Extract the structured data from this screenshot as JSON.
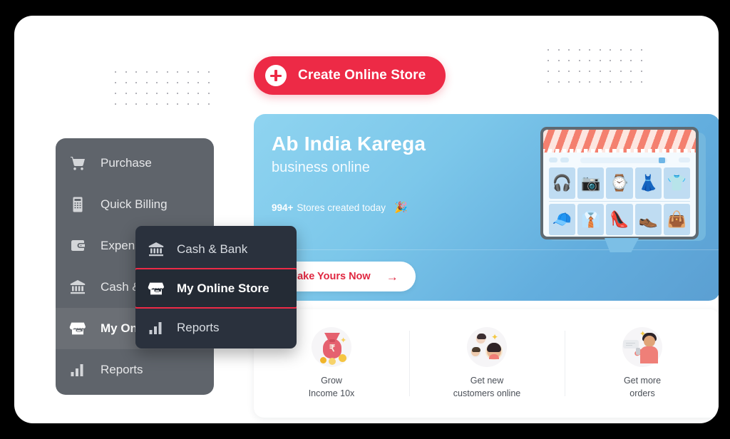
{
  "window": {
    "background_color": "#000000",
    "card_color": "#ffffff"
  },
  "theme": {
    "accent_red": "#ed2a46",
    "hero_blue_light": "#8fd4f0",
    "hero_blue_dark": "#5b9fd2",
    "sidebar_gray": "#5f646b",
    "flyout_dark": "#2a313d"
  },
  "toolbar": {
    "create_store_button": "Create Online Store",
    "plus_icon": "plus-circle-icon"
  },
  "hero": {
    "title": "Ab India Karega",
    "subtitle": "business online",
    "stat_count": "994+",
    "stat_text": "Stores created today",
    "stat_emoji": "🎉",
    "cta_label": "Make Yours Now",
    "cta_arrow": "→",
    "illustration": {
      "name": "online-storefront-illustration",
      "row1": [
        "🎧",
        "📷",
        "⌚",
        "👗",
        "👕"
      ],
      "row2": [
        "🧢",
        "👔",
        "👠",
        "👞",
        "👜"
      ]
    }
  },
  "features": [
    {
      "icon": "money-bag-icon",
      "line1": "Grow",
      "line2": "Income 10x"
    },
    {
      "icon": "people-group-icon",
      "line1": "Get new",
      "line2": "customers online"
    },
    {
      "icon": "person-phone-icon",
      "line1": "Get more",
      "line2": "orders"
    }
  ],
  "sidebar": {
    "items": [
      {
        "label": "Purchase",
        "icon": "shopping-cart-icon",
        "active": false
      },
      {
        "label": "Quick Billing",
        "icon": "calculator-icon",
        "active": false
      },
      {
        "label": "Expense",
        "icon": "wallet-icon",
        "active": false
      },
      {
        "label": "Cash & Bank",
        "icon": "bank-icon",
        "active": false
      },
      {
        "label": "My Online Store",
        "icon": "store-icon",
        "active": true
      },
      {
        "label": "Reports",
        "icon": "bar-chart-icon",
        "active": false
      }
    ]
  },
  "flyout_menu": {
    "items": [
      {
        "label": "Cash & Bank",
        "icon": "bank-icon",
        "selected": false
      },
      {
        "label": "My Online Store",
        "icon": "store-icon",
        "selected": true
      },
      {
        "label": "Reports",
        "icon": "bar-chart-icon",
        "selected": false
      }
    ]
  },
  "decor": {
    "dot_grid_columns": 10,
    "dot_grid_rows": 4
  }
}
